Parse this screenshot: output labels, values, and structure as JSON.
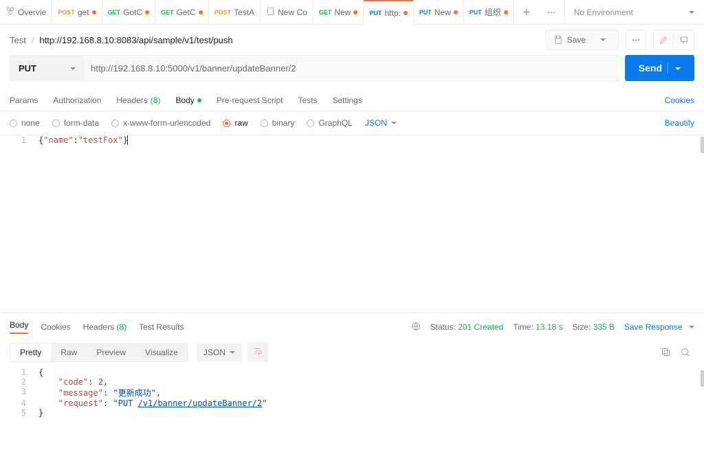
{
  "tabs": [
    {
      "kind": "overview",
      "label": "Overvie"
    },
    {
      "method": "POST",
      "label": "get"
    },
    {
      "method": "GET",
      "label": "GotC"
    },
    {
      "method": "GET",
      "label": "GetC"
    },
    {
      "method": "POST",
      "label": "TestA"
    },
    {
      "kind": "new",
      "label": "New Co"
    },
    {
      "method": "GET",
      "label": "New"
    },
    {
      "method": "PUT",
      "label": "http:",
      "active": true
    },
    {
      "method": "PUT",
      "label": "New"
    },
    {
      "method": "PUT",
      "label": "组织"
    }
  ],
  "env": {
    "label": "No Environment"
  },
  "breadcrumb": {
    "root": "Test",
    "name": "http://192.168.8.10:8083/api/sample/v1/test/push"
  },
  "save": {
    "label": "Save"
  },
  "request": {
    "method": "PUT",
    "url": "http://192.168.8.10:5000/v1/banner/updateBanner/2",
    "send": "Send"
  },
  "reqTabs": {
    "params": "Params",
    "auth": "Authorization",
    "headers": "Headers",
    "headersCount": "(8)",
    "body": "Body",
    "prereq": "Pre-request Script",
    "tests": "Tests",
    "settings": "Settings",
    "cookies": "Cookies"
  },
  "bodyType": {
    "none": "none",
    "form": "form-data",
    "url": "x-www-form-urlencoded",
    "raw": "raw",
    "binary": "binary",
    "gql": "GraphQL",
    "json": "JSON",
    "beautify": "Beautify"
  },
  "bodyLines": {
    "ln": "1",
    "pre": "{",
    "k": "\"name\"",
    "c": ":",
    "v": "\"testFox\"",
    "post": "}"
  },
  "respTabs": {
    "body": "Body",
    "cookies": "Cookies",
    "headers": "Headers",
    "headersCount": "(8)",
    "tests": "Test Results"
  },
  "meta": {
    "statusLabel": "Status:",
    "status": "201 Created",
    "timeLabel": "Time:",
    "time": "13.18 s",
    "sizeLabel": "Size:",
    "size": "335 B",
    "save": "Save Response"
  },
  "view": {
    "pretty": "Pretty",
    "raw": "Raw",
    "preview": "Preview",
    "visualize": "Visualize",
    "json": "JSON"
  },
  "response": {
    "l1": {
      "n": "1",
      "t": "{"
    },
    "l2": {
      "n": "2",
      "k": "\"code\"",
      "c": ": ",
      "v": "2",
      "t": ","
    },
    "l3": {
      "n": "3",
      "k": "\"message\"",
      "c": ": ",
      "v": "\"更新成功\"",
      "t": ","
    },
    "l4": {
      "n": "4",
      "k": "\"request\"",
      "c": ": ",
      "v1": "\"PUT ",
      "v2": "/v1/banner/updateBanner/2",
      "v3": "\""
    },
    "l5": {
      "n": "5",
      "t": "}"
    }
  }
}
